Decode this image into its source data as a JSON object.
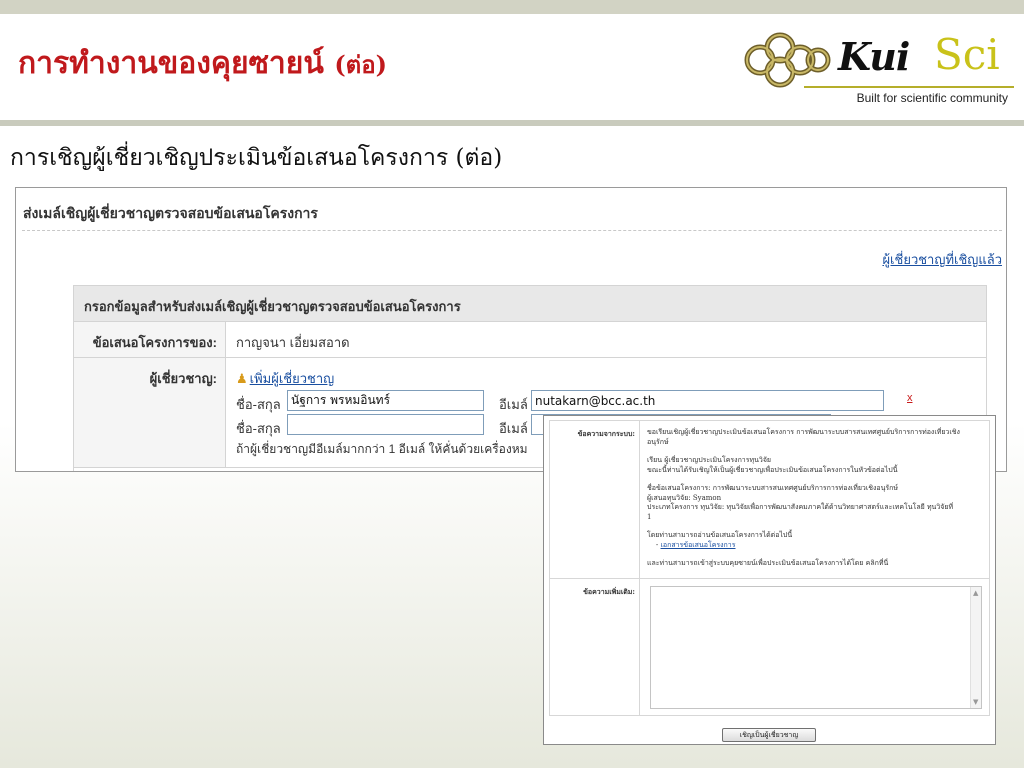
{
  "slide": {
    "title": "การทำงานของคุยซายน์",
    "title_suffix": "(ต่อ)",
    "subtitle": "การเชิญผู้เชี่ยวเชิญประเมินข้อเสนอโครงการ (ต่อ)"
  },
  "logo": {
    "kui": "Kui",
    "sci": "Sci",
    "tagline": "Built for scientific community",
    "icon": "knot-logo-icon"
  },
  "main_panel": {
    "title": "ส่งเมล์เชิญผู้เชี่ยวชาญตรวจสอบข้อเสนอโครงการ",
    "invited_link": "ผู้เชี่ยวชาญที่เชิญแล้ว",
    "form_header": "กรอกข้อมูลสำหรับส่งเมล์เชิญผู้เชี่ยวชาญตรวจสอบข้อเสนอโครงการ",
    "owner_label": "ข้อเสนอโครงการของ:",
    "owner_value": "กาญจนา เอี่ยมสอาด",
    "experts_label": "ผู้เชี่ยวชาญ:",
    "add_expert": "เพิ่มผู้เชี่ยวชาญ",
    "name_label": "ชื่อ-สกุล",
    "email_label": "อีเมล์",
    "expert1_name": "นัฐการ พรหมอินทร์",
    "expert1_email": "nutakarn@bcc.ac.th",
    "expert2_name": "",
    "remove": "x",
    "note": "ถ้าผู้เชี่ยวชาญมีอีเมล์มากกว่า 1 อีเมล์ ให้คั่นด้วยเครื่องหม"
  },
  "overlay_panel": {
    "system_msg_label": "ข้อความจากระบบ:",
    "system_msg_lines": [
      "ขอเรียนเชิญผู้เชี่ยวชาญประเมินข้อเสนอโครงการ การพัฒนาระบบสารสนเทศศูนย์บริการการท่องเที่ยวเชิง",
      "อนุรักษ์",
      "",
      "เรียน ผู้เชี่ยวชาญประเมินโครงการทุนวิจัย",
      "   ขณะนี้ท่านได้รับเชิญให้เป็นผู้เชี่ยวชาญเพื่อประเมินข้อเสนอโครงการในหัวข้อต่อไปนี้",
      "",
      "   ชื่อข้อเสนอโครงการ: การพัฒนาระบบสารสนเทศศูนย์บริการการท่องเที่ยวเชิงอนุรักษ์",
      "   ผู้เสนอทุนวิจัย: Syamon",
      "   ประเภทโครงการ ทุนวิจัย: ทุนวิจัยเพื่อการพัฒนาสังคมภาคใต้ด้านวิทยาศาสตร์และเทคโนโลยี ทุนวิจัยที่",
      "1",
      "",
      "   โดยท่านสามารถอ่านข้อเสนอโครงการได้ต่อไปนี้"
    ],
    "doc_link": "เอกสารข้อเสนอโครงการ",
    "closing": "และท่านสามารถเข้าสู่ระบบคุยซายน์เพื่อประเมินข้อเสนอโครงการได้โดย คลิกที่นี่",
    "extra_msg_label": "ข้อความเพิ่มเติม:",
    "button": "เชิญเป็นผู้เชี่ยวชาญ"
  },
  "colors": {
    "title_red": "#c0191c",
    "link_blue": "#1a4fa0",
    "logo_gold": "#c9c21a"
  }
}
